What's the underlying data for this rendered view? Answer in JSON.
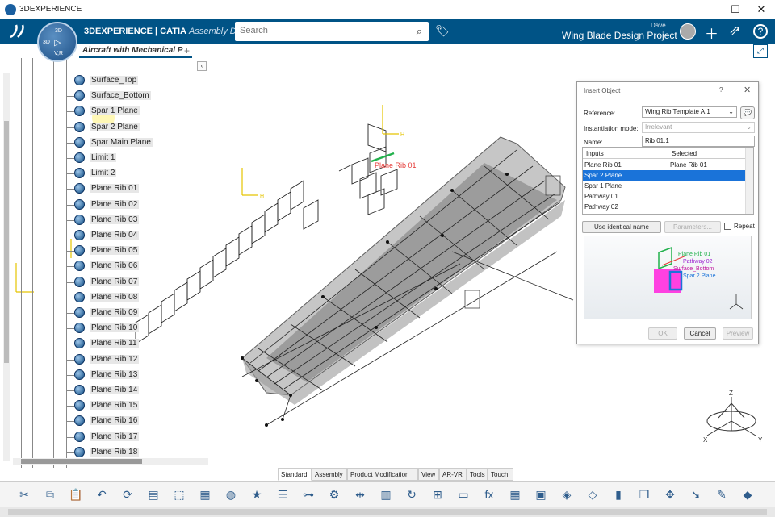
{
  "window": {
    "title": "3DEXPERIENCE",
    "minimize": "—",
    "maximize": "☐",
    "close": "✕"
  },
  "header": {
    "brand_main": "3DEXPERIENCE | CATIA",
    "brand_app": "Assembly Des",
    "search_placeholder": "Search",
    "user": "Dave",
    "project": "Wing Blade Design Project",
    "compass": {
      "top": "3D",
      "left": "3D",
      "bottom": "V,R"
    }
  },
  "tabs": {
    "active": "Aircraft with Mechanical P",
    "add": "+"
  },
  "tree": {
    "items": [
      "Surface_Top",
      "Surface_Bottom",
      "Spar 1 Plane",
      "Spar 2 Plane",
      "Spar Main Plane",
      "Limit 1",
      "Limit 2",
      "Plane Rib 01",
      "Plane Rib 02",
      "Plane Rib 03",
      "Plane Rib 04",
      "Plane Rib 05",
      "Plane Rib 06",
      "Plane Rib 07",
      "Plane Rib 08",
      "Plane Rib 09",
      "Plane Rib 10",
      "Plane Rib 11",
      "Plane Rib 12",
      "Plane Rib 13",
      "Plane Rib 14",
      "Plane Rib 15",
      "Plane Rib 16",
      "Plane Rib 17",
      "Plane Rib 18"
    ],
    "collapse": "‹"
  },
  "viewport": {
    "annotation": "Plane Rib 01",
    "axis_h": "H",
    "axis_v": "V"
  },
  "dialog": {
    "title": "Insert Object",
    "help": "?",
    "close": "✕",
    "reference_label": "Reference:",
    "reference_value": "Wing Rib Template A.1",
    "mode_label": "Instantiation mode:",
    "mode_value": "Irrelevant",
    "name_label": "Name:",
    "name_value": "Rib 01.1",
    "col_inputs": "Inputs",
    "col_selected": "Selected",
    "rows": [
      {
        "input": "Plane Rib 01",
        "selected": "Plane Rib 01"
      },
      {
        "input": "Spar 2 Plane",
        "selected": ""
      },
      {
        "input": "Spar 1 Plane",
        "selected": ""
      },
      {
        "input": "Pathway 01",
        "selected": ""
      },
      {
        "input": "Pathway 02",
        "selected": ""
      }
    ],
    "use_identical": "Use identical name",
    "parameters": "Parameters...",
    "repeat": "Repeat",
    "preview_labels": [
      "Plane Rib 01",
      "Pathway 02",
      "Surface_Bottom",
      "Spar 2 Plane"
    ],
    "ok": "OK",
    "cancel": "Cancel",
    "preview_btn": "Preview"
  },
  "compass_axes": {
    "z": "Z",
    "x": "X",
    "y": "Y"
  },
  "bottom_tabs": [
    "Standard",
    "Assembly",
    "Product Modification",
    "View",
    "AR-VR",
    "Tools",
    "Touch"
  ],
  "toolbar_icons": [
    "scissors-icon",
    "copy-icon",
    "paste-icon",
    "undo-icon",
    "update-icon",
    "catalog-icon",
    "select-icon",
    "table-icon",
    "globe-icon",
    "star-icon",
    "list-icon",
    "tree-icon",
    "settings-icon",
    "measure-icon",
    "books-icon",
    "refresh-icon",
    "hierarchy-icon",
    "file-icon",
    "formula-icon",
    "grid-icon",
    "chart-icon",
    "cube-icon",
    "tag-icon",
    "signal-icon",
    "pages-icon",
    "transform-icon",
    "arrow-icon",
    "pen-icon",
    "drop-icon"
  ],
  "colors": {
    "brand": "#005386",
    "selection": "#1a73d9",
    "annotation": "#e53935",
    "preview_magenta": "#ff2ddf"
  }
}
